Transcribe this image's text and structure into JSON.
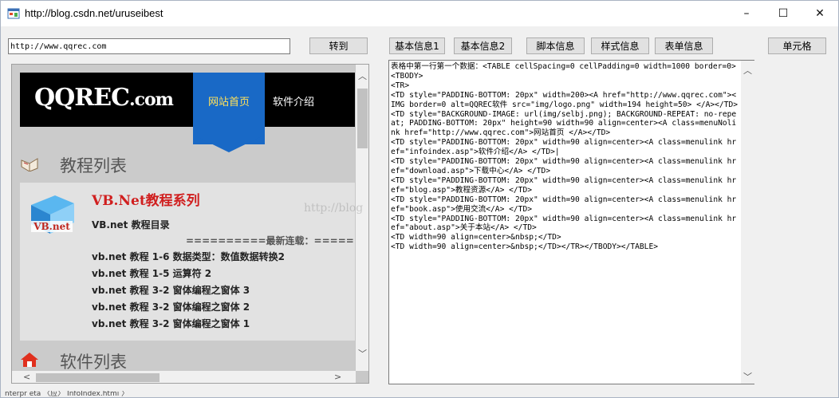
{
  "window": {
    "title": "http://blog.csdn.net/uruseibest",
    "controls": {
      "minimize": "–",
      "maximize": "☐",
      "close": "✕"
    }
  },
  "toolbar": {
    "url_value": "http://www.qqrec.com",
    "go_label": "转到",
    "basic1_label": "基本信息1",
    "basic2_label": "基本信息2",
    "script_label": "脚本信息",
    "style_label": "样式信息",
    "form_label": "表单信息",
    "cell_label": "单元格"
  },
  "site": {
    "logo_main": "QQREC",
    "logo_suffix": ".com",
    "nav": [
      {
        "label": "网站首页",
        "active": true
      },
      {
        "label": "软件介绍",
        "active": false
      }
    ],
    "tutorials_title": "教程列表",
    "series_title": "VB.Net教程系列",
    "series_sub": "VB.net 教程目录",
    "latest_banner": "==========最新连载：=====",
    "articles": [
      "vb.net 教程 1-6 数据类型：数值数据转换2",
      "vb.net 教程 1-5 运算符 2",
      "vb.net 教程 3-2 窗体编程之窗体 3",
      "vb.net 教程 3-2 窗体编程之窗体 2",
      "vb.net 教程 3-2 窗体编程之窗体 1"
    ],
    "software_title": "软件列表",
    "vb_logo_text": "VB.net"
  },
  "output": {
    "text": "表格中第一行第一个数据：<TABLE cellSpacing=0 cellPadding=0 width=1000 border=0>\n<TBODY>\n<TR>\n<TD style=\"PADDING-BOTTOM: 20px\" width=200><A href=\"http://www.qqrec.com\"><IMG border=0 alt=QQREC软件 src=\"img/logo.png\" width=194 height=50> </A></TD>\n<TD style=\"BACKGROUND-IMAGE: url(img/selbj.png); BACKGROUND-REPEAT: no-repeat; PADDING-BOTTOM: 20px\" height=90 width=90 align=center><A class=menuNolink href=\"http://www.qqrec.com\">网站首页 </A></TD>\n<TD style=\"PADDING-BOTTOM: 20px\" width=90 align=center><A class=menulink href=\"infoindex.asp\">软件介绍</A> </TD>|\n<TD style=\"PADDING-BOTTOM: 20px\" width=90 align=center><A class=menulink href=\"download.asp\">下载中心</A> </TD>\n<TD style=\"PADDING-BOTTOM: 20px\" width=90 align=center><A class=menulink href=\"blog.asp\">教程资源</A> </TD>\n<TD style=\"PADDING-BOTTOM: 20px\" width=90 align=center><A class=menulink href=\"book.asp\">使用交流</A> </TD>\n<TD style=\"PADDING-BOTTOM: 20px\" width=90 align=center><A class=menulink href=\"about.asp\">关于本站</A> </TD>\n<TD width=90 align=center>&nbsp;</TD>\n<TD width=90 align=center>&nbsp;</TD></TR></TBODY></TABLE>",
    "watermark": "http://blog"
  },
  "status": {
    "text": "nterpr eta  〈应〉  InfoIndex.htmi  〉"
  },
  "colors": {
    "nav_active": "#1969c6",
    "nav_active_text": "#ffe15a",
    "series_title": "#d01f1f",
    "header_bg": "#000000"
  }
}
